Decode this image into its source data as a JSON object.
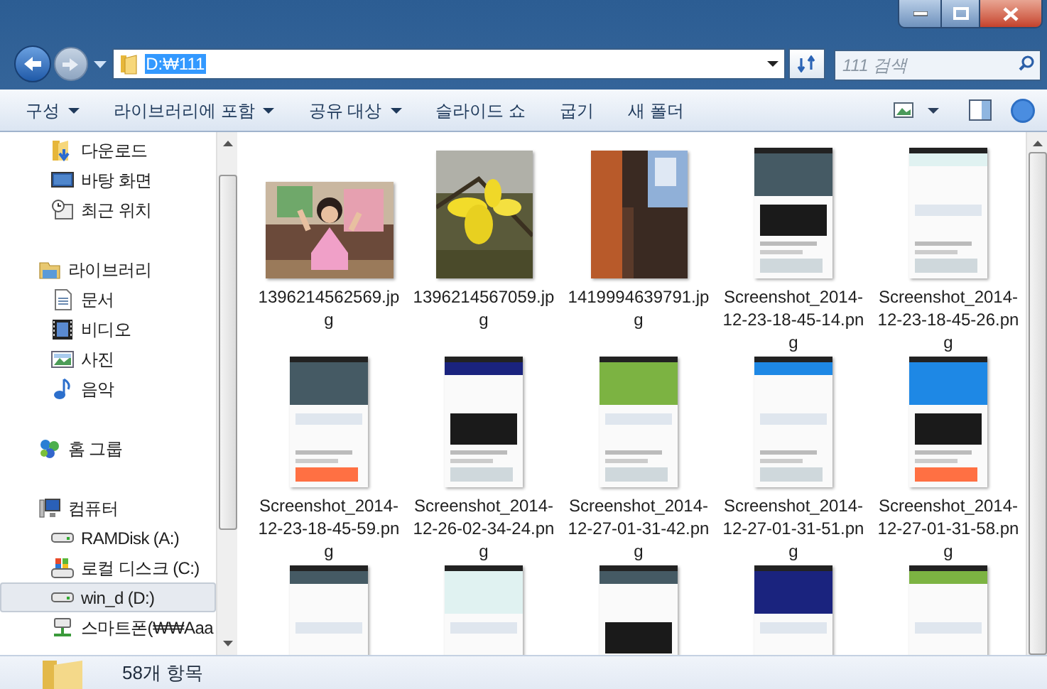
{
  "address": {
    "value": "D:₩111"
  },
  "search": {
    "placeholder": "111 검색"
  },
  "toolbar": [
    {
      "label": "구성",
      "menu": true
    },
    {
      "label": "라이브러리에 포함",
      "menu": true
    },
    {
      "label": "공유 대상",
      "menu": true
    },
    {
      "label": "슬라이드 쇼",
      "menu": false
    },
    {
      "label": "굽기",
      "menu": false
    },
    {
      "label": "새 폴더",
      "menu": false
    }
  ],
  "sidebar": {
    "items": [
      {
        "children": [
          {
            "label": "다운로드",
            "kind": "download",
            "selected": false
          },
          {
            "label": "바탕 화면",
            "kind": "desktop",
            "selected": false
          },
          {
            "label": "최근 위치",
            "kind": "recent",
            "selected": false
          }
        ]
      },
      {
        "label": "라이브러리",
        "kind": "library",
        "selected": false,
        "children": [
          {
            "label": "문서",
            "kind": "document",
            "selected": false
          },
          {
            "label": "비디오",
            "kind": "video",
            "selected": false
          },
          {
            "label": "사진",
            "kind": "pictures",
            "selected": false
          },
          {
            "label": "음악",
            "kind": "music",
            "selected": false
          }
        ]
      },
      {
        "label": "홈 그룹",
        "kind": "homegroup",
        "selected": false
      },
      {
        "label": "컴퓨터",
        "kind": "computer",
        "selected": false,
        "children": [
          {
            "label": "RAMDisk (A:)",
            "kind": "drive",
            "selected": false
          },
          {
            "label": "로컬 디스크 (C:)",
            "kind": "system-drive",
            "selected": false
          },
          {
            "label": "win_d (D:)",
            "kind": "drive",
            "selected": true
          },
          {
            "label": "스마트폰(₩₩Aaa",
            "kind": "network-drive",
            "selected": false
          }
        ]
      }
    ]
  },
  "files": [
    {
      "name": "1396214562569.jpg",
      "kind": "picture"
    },
    {
      "name": "1396214567059.jpg",
      "kind": "picture"
    },
    {
      "name": "1419994639791.jpg",
      "kind": "picture"
    },
    {
      "name": "Screenshot_2014-12-23-18-45-14.png",
      "kind": "picture"
    },
    {
      "name": "Screenshot_2014-12-23-18-45-26.png",
      "kind": "picture"
    },
    {
      "name": "Screenshot_2014-12-23-18-45-59.png",
      "kind": "picture"
    },
    {
      "name": "Screenshot_2014-12-26-02-34-24.png",
      "kind": "picture"
    },
    {
      "name": "Screenshot_2014-12-27-01-31-42.png",
      "kind": "picture"
    },
    {
      "name": "Screenshot_2014-12-27-01-31-51.png",
      "kind": "picture"
    },
    {
      "name": "Screenshot_2014-12-27-01-31-58.png",
      "kind": "picture"
    },
    {
      "kind": "picture"
    },
    {
      "kind": "picture"
    },
    {
      "kind": "picture"
    },
    {
      "kind": "picture"
    },
    {
      "kind": "picture"
    }
  ],
  "status_bar": {
    "text": "58개 항목"
  }
}
